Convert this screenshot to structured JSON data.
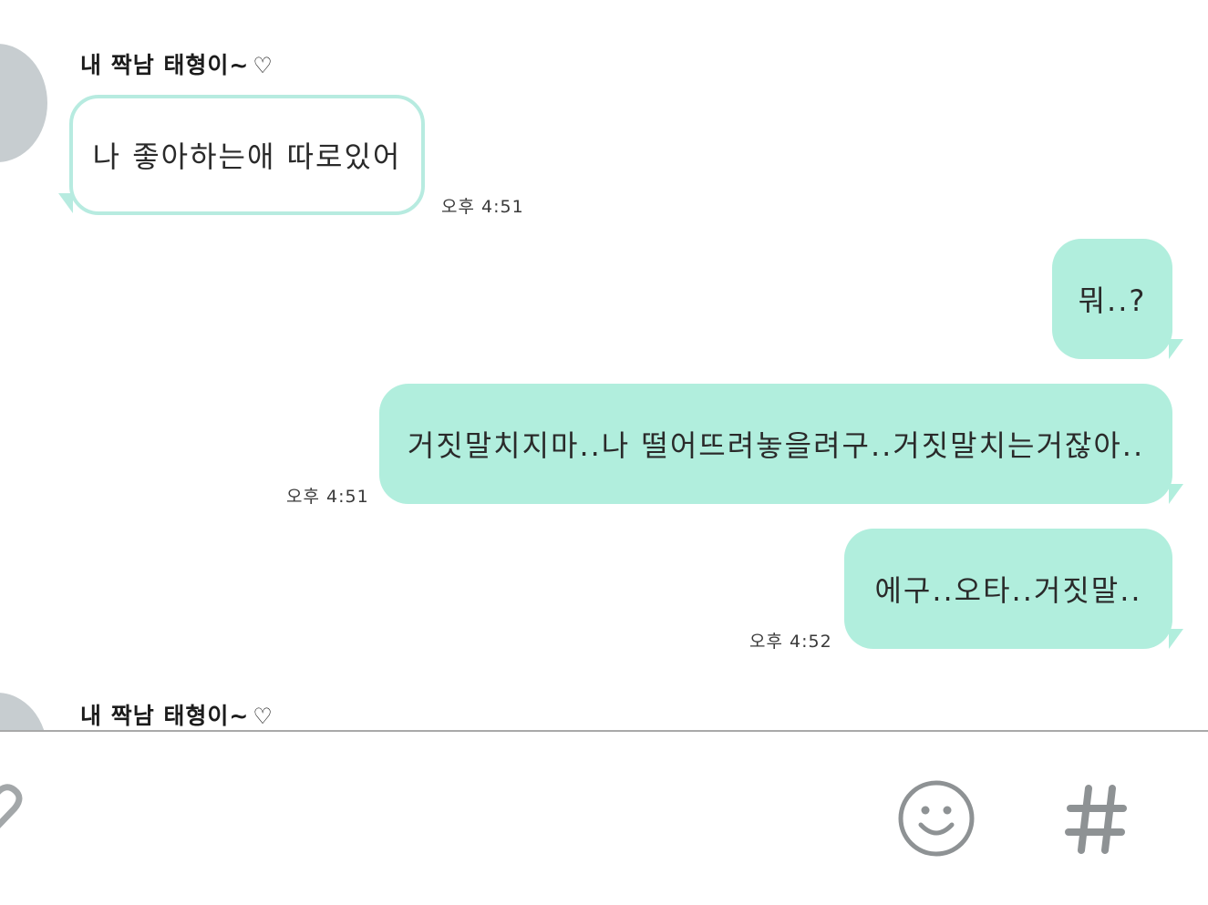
{
  "messages": [
    {
      "direction": "incoming",
      "sender": "내 짝남 태형이~",
      "text": "나 좋아하는애 따로있어",
      "time": "오후 4:51"
    },
    {
      "direction": "outgoing",
      "text": "뭐..?",
      "time": ""
    },
    {
      "direction": "outgoing",
      "text": "거짓말치지마..나 떨어뜨려놓을려구..거짓말치는거잖아..",
      "time": "오후 4:51"
    },
    {
      "direction": "outgoing",
      "text": "에구..오타..거짓말..",
      "time": "오후 4:52"
    },
    {
      "direction": "incoming",
      "sender": "내 짝남 태형이~",
      "text": "",
      "time": ""
    }
  ],
  "icons": {
    "heart": "heart-icon",
    "attach": "attach-icon",
    "emoji": "smiley-icon",
    "hashtag": "hashtag-icon"
  },
  "colors": {
    "outgoing_bubble": "#b1eedd",
    "incoming_border": "#b7ebe0",
    "icon_gray": "#8e9294"
  }
}
